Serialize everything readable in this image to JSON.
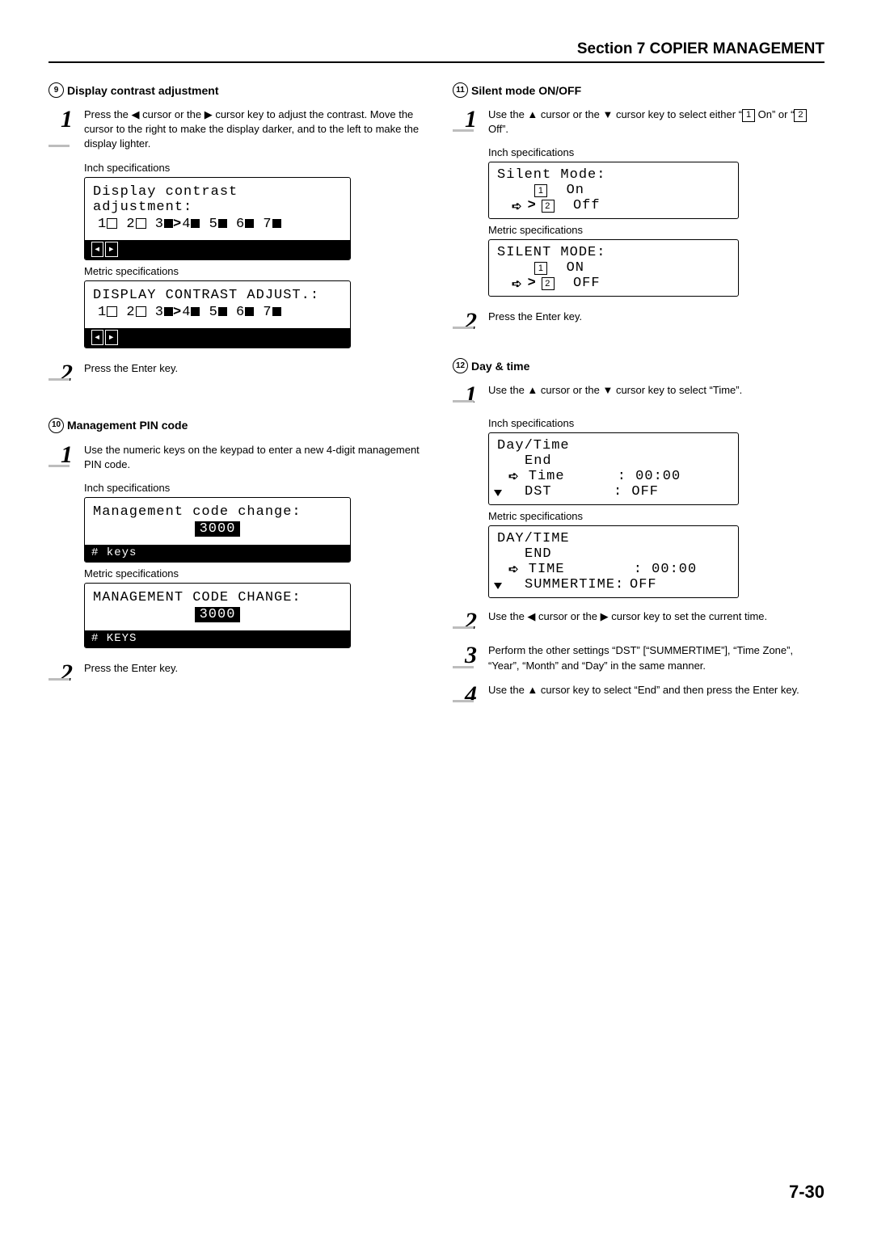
{
  "header": {
    "label": "Section 7  COPIER MANAGEMENT"
  },
  "left": {
    "s9": {
      "num": "9",
      "title": "Display contrast adjustment",
      "step1": "Press the ◀ cursor or the ▶ cursor key to adjust the contrast. Move the cursor to the right to make the display darker, and to the left to make the display lighter.",
      "inchLabel": "Inch specifications",
      "lcd1_line1": "Display contrast adjustment:",
      "scale_prefix": [
        "1",
        "2",
        "3",
        "4",
        "5",
        "6",
        "7"
      ],
      "metricLabel": "Metric specifications",
      "lcd2_line1": "DISPLAY CONTRAST ADJUST.:",
      "step2": "Press the Enter key."
    },
    "s10": {
      "num": "10",
      "title": "Management PIN code",
      "step1": "Use the numeric keys on the keypad to enter a new 4-digit management PIN code.",
      "inchLabel": "Inch specifications",
      "lcd1_line1": "Management code change:",
      "pin": "3000",
      "foot1": "# keys",
      "metricLabel": "Metric specifications",
      "lcd2_line1": "MANAGEMENT CODE CHANGE:",
      "foot2": "# KEYS",
      "step2": "Press the Enter key."
    }
  },
  "right": {
    "s11": {
      "num": "11",
      "title": "Silent mode ON/OFF",
      "step1_a": "Use the ▲ cursor or the ▼ cursor key to select either “",
      "step1_b": " On” or “",
      "step1_c": " Off”.",
      "inchLabel": "Inch specifications",
      "lcd1_title": "Silent Mode:",
      "opt1": "On",
      "opt2": "Off",
      "metricLabel": "Metric specifications",
      "lcd2_title": "SILENT MODE:",
      "opt1u": "ON",
      "opt2u": "OFF",
      "step2": "Press the Enter key."
    },
    "s12": {
      "num": "12",
      "title": "Day & time",
      "step1": "Use the ▲ cursor or the ▼ cursor key to select “Time”.",
      "inchLabel": "Inch specifications",
      "lcd1_title": "Day/Time",
      "lcd1_l2": "End",
      "lcd1_l3a": "Time",
      "lcd1_l3b": ": 00:00",
      "lcd1_l4a": "DST",
      "lcd1_l4b": ": OFF",
      "metricLabel": "Metric specifications",
      "lcd2_title": "DAY/TIME",
      "lcd2_l2": "END",
      "lcd2_l3a": "TIME",
      "lcd2_l3b": ": 00:00",
      "lcd2_l4a": "SUMMERTIME:",
      "lcd2_l4b": "OFF",
      "step2": "Use the ◀ cursor or the ▶ cursor key to set the current time.",
      "step3": "Perform the other settings “DST” [“SUMMERTIME”], “Time Zone”, “Year”, “Month” and “Day” in the same manner.",
      "step4": "Use the ▲ cursor key to select “End” and then press the Enter key."
    }
  },
  "pageNumber": "7-30"
}
